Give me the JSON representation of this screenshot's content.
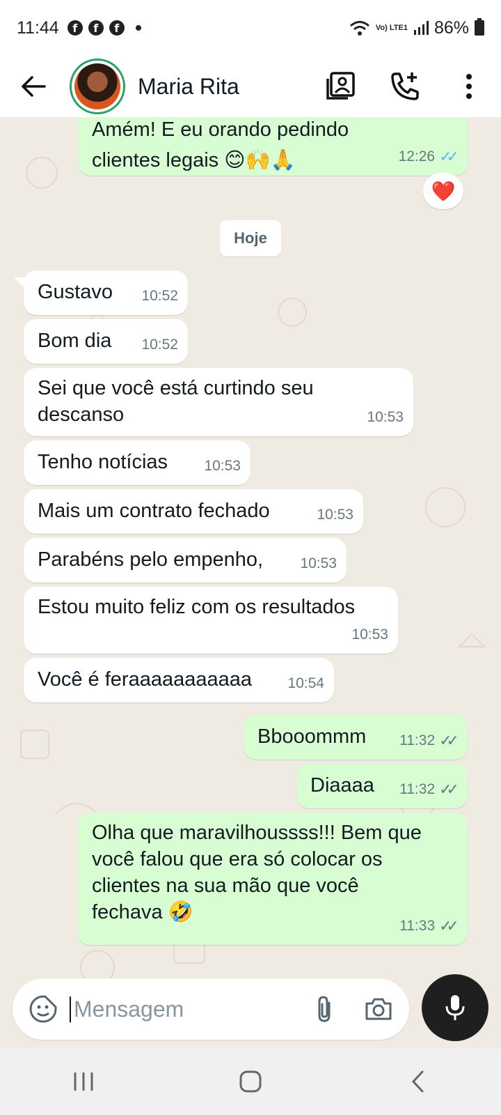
{
  "status_bar": {
    "time": "11:44",
    "network": "Vo) LTE1",
    "battery": "86%"
  },
  "header": {
    "contact_name": "Maria Rita"
  },
  "chat": {
    "date_chip": "Hoje",
    "partial_message": {
      "text": "Amém! E eu orando pedindo clientes legais 😊🙌🙏",
      "time": "12:26",
      "status": "read",
      "reaction": "❤️"
    },
    "messages": [
      {
        "direction": "in",
        "text": "Gustavo",
        "time": "10:52"
      },
      {
        "direction": "in",
        "text": "Bom dia",
        "time": "10:52"
      },
      {
        "direction": "in",
        "text": "Sei que você está curtindo seu descanso",
        "time": "10:53"
      },
      {
        "direction": "in",
        "text": "Tenho notícias",
        "time": "10:53"
      },
      {
        "direction": "in",
        "text": "Mais um contrato fechado",
        "time": "10:53"
      },
      {
        "direction": "in",
        "text": "Parabéns pelo empenho,",
        "time": "10:53"
      },
      {
        "direction": "in",
        "text": "Estou muito feliz com os resultados",
        "time": "10:53"
      },
      {
        "direction": "in",
        "text": "Você é feraaaaaaaaaaa",
        "time": "10:54"
      },
      {
        "direction": "out",
        "text": "Bbooommm",
        "time": "11:32",
        "status": "delivered"
      },
      {
        "direction": "out",
        "text": "Diaaaa",
        "time": "11:32",
        "status": "delivered"
      },
      {
        "direction": "out",
        "text": "Olha que maravilhoussss!!! Bem que você falou que era só colocar os clientes na sua mão que você fechava 🤣",
        "time": "11:33",
        "status": "delivered"
      }
    ]
  },
  "composer": {
    "placeholder": "Mensagem"
  },
  "colors": {
    "incoming": "#ffffff",
    "outgoing": "#d9fdd3",
    "read_ticks": "#53bdeb",
    "background": "#efeae2",
    "avatar_ring": "#25a366"
  }
}
